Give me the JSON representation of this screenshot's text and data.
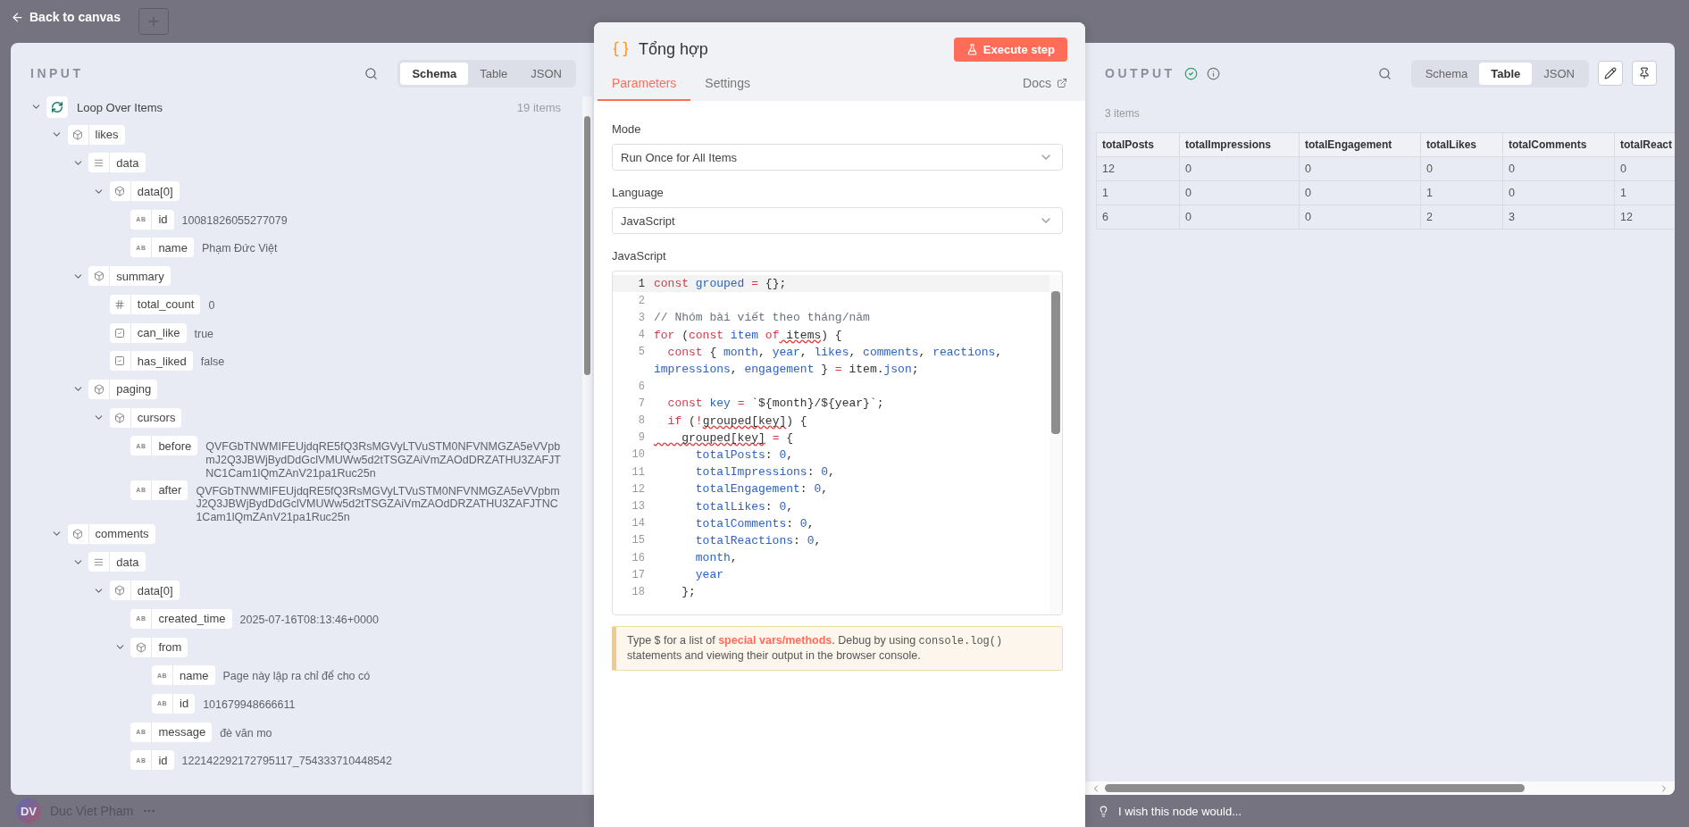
{
  "topbar": {
    "back_label": "Back to canvas"
  },
  "user": {
    "initials": "DV",
    "name": "Duc Viet Pham"
  },
  "input": {
    "title": "INPUT",
    "view_tabs": [
      {
        "label": "Schema",
        "selected": true
      },
      {
        "label": "Table",
        "selected": false
      },
      {
        "label": "JSON",
        "selected": false
      }
    ],
    "tree": {
      "name": "Loop Over Items",
      "count": "19 items",
      "expanded": true,
      "children": [
        {
          "name": "likes",
          "kind": "object",
          "expanded": true,
          "children": [
            {
              "name": "data",
              "kind": "array",
              "expanded": true,
              "children": [
                {
                  "name": "data[0]",
                  "kind": "object",
                  "expanded": true,
                  "children": [
                    {
                      "name": "id",
                      "kind": "string",
                      "type_label": "AB",
                      "value": "10081826055277079"
                    },
                    {
                      "name": "name",
                      "kind": "string",
                      "type_label": "AB",
                      "value": "Phạm Đức Việt"
                    }
                  ]
                }
              ]
            },
            {
              "name": "summary",
              "kind": "object",
              "expanded": true,
              "children": [
                {
                  "name": "total_count",
                  "kind": "number",
                  "value": "0"
                },
                {
                  "name": "can_like",
                  "kind": "boolean",
                  "value": "true"
                },
                {
                  "name": "has_liked",
                  "kind": "boolean",
                  "value": "false"
                }
              ]
            },
            {
              "name": "paging",
              "kind": "object",
              "expanded": true,
              "children": [
                {
                  "name": "cursors",
                  "kind": "object",
                  "expanded": true,
                  "children": [
                    {
                      "name": "before",
                      "kind": "string",
                      "type_label": "AB",
                      "value": "QVFGbTNWMIFEUjdqRE5fQ3RsMGVyLTVuSTM0NFVNMGZA5eVVpbmJ2Q3JBWjBydDdGclVMUWw5d2tTSGZAiVmZAOdDRZATHU3ZAFJTNC1Cam1lQmZAnV21pa1Ruc25n"
                    },
                    {
                      "name": "after",
                      "kind": "string",
                      "type_label": "AB",
                      "value": "QVFGbTNWMIFEUjdqRE5fQ3RsMGVyLTVuSTM0NFVNMGZA5eVVpbmJ2Q3JBWjBydDdGclVMUWw5d2tTSGZAiVmZAOdDRZATHU3ZAFJTNC1Cam1lQmZAnV21pa1Ruc25n"
                    }
                  ]
                }
              ]
            }
          ]
        },
        {
          "name": "comments",
          "kind": "object",
          "expanded": true,
          "children": [
            {
              "name": "data",
              "kind": "array",
              "expanded": true,
              "children": [
                {
                  "name": "data[0]",
                  "kind": "object",
                  "expanded": true,
                  "children": [
                    {
                      "name": "created_time",
                      "kind": "string",
                      "type_label": "AB",
                      "value": "2025-07-16T08:13:46+0000"
                    },
                    {
                      "name": "from",
                      "kind": "object",
                      "expanded": true,
                      "children": [
                        {
                          "name": "name",
                          "kind": "string",
                          "type_label": "AB",
                          "value": "Page này lập ra chỉ để cho có"
                        },
                        {
                          "name": "id",
                          "kind": "string",
                          "type_label": "AB",
                          "value": "101679948666611"
                        }
                      ]
                    },
                    {
                      "name": "message",
                      "kind": "string",
                      "type_label": "AB",
                      "value": "đè văn mo"
                    },
                    {
                      "name": "id",
                      "kind": "string",
                      "type_label": "AB",
                      "value": "122142292172795117_754333710448542"
                    }
                  ]
                }
              ]
            }
          ]
        }
      ]
    }
  },
  "node": {
    "title": "Tổng hợp",
    "execute_label": "Execute step",
    "tabs": [
      {
        "label": "Parameters",
        "selected": true
      },
      {
        "label": "Settings",
        "selected": false
      }
    ],
    "docs_label": "Docs",
    "fields": [
      {
        "label": "Mode",
        "value": "Run Once for All Items"
      },
      {
        "label": "Language",
        "value": "JavaScript"
      }
    ],
    "code_label": "JavaScript",
    "code_lines": [
      {
        "n": "1",
        "active": true,
        "tokens": [
          {
            "kind": "keyword",
            "text": "const"
          },
          {
            "kind": "name",
            "text": " grouped"
          },
          {
            "kind": "keyword",
            "text": " ="
          },
          {
            "kind": "plain",
            "text": " {};"
          }
        ]
      },
      {
        "n": "2",
        "active": false
      },
      {
        "n": "3",
        "active": false,
        "tokens": [
          {
            "kind": "comment",
            "text": "// Nhóm bài viết theo tháng/năm"
          }
        ]
      },
      {
        "n": "4",
        "active": false,
        "tokens": [
          {
            "kind": "keyword",
            "text": "for"
          },
          {
            "kind": "plain",
            "text": " ("
          },
          {
            "kind": "keyword",
            "text": "const"
          },
          {
            "kind": "name",
            "text": " item"
          },
          {
            "kind": "keyword",
            "text": " of"
          },
          {
            "kind": "error",
            "text": " items"
          },
          {
            "kind": "plain",
            "text": ") {"
          }
        ]
      },
      {
        "n": "5",
        "active": false,
        "tokens": [
          {
            "kind": "keyword",
            "text": "  const"
          },
          {
            "kind": "plain",
            "text": " { "
          },
          {
            "kind": "name",
            "text": "month"
          },
          {
            "kind": "plain",
            "text": ", "
          },
          {
            "kind": "name",
            "text": "year"
          },
          {
            "kind": "plain",
            "text": ", "
          },
          {
            "kind": "name",
            "text": "likes"
          },
          {
            "kind": "plain",
            "text": ", "
          },
          {
            "kind": "name",
            "text": "comments"
          },
          {
            "kind": "plain",
            "text": ", "
          },
          {
            "kind": "name",
            "text": "reactions"
          },
          {
            "kind": "plain",
            "text": ","
          }
        ]
      },
      {
        "active": false,
        "tokens": [
          {
            "kind": "name",
            "text": "impressions"
          },
          {
            "kind": "plain",
            "text": ", "
          },
          {
            "kind": "name",
            "text": "engagement"
          },
          {
            "kind": "plain",
            "text": " } "
          },
          {
            "kind": "keyword",
            "text": "="
          },
          {
            "kind": "plain",
            "text": " item."
          },
          {
            "kind": "name",
            "text": "json"
          },
          {
            "kind": "plain",
            "text": ";"
          }
        ]
      },
      {
        "n": "6",
        "active": false
      },
      {
        "n": "7",
        "active": false,
        "tokens": [
          {
            "kind": "keyword",
            "text": "  const"
          },
          {
            "kind": "name",
            "text": " key"
          },
          {
            "kind": "keyword",
            "text": " ="
          },
          {
            "kind": "plain",
            "text": " `${month}/${year}`;"
          }
        ]
      },
      {
        "n": "8",
        "active": false,
        "tokens": [
          {
            "kind": "keyword",
            "text": "  if"
          },
          {
            "kind": "plain",
            "text": " ("
          },
          {
            "kind": "keyword",
            "text": "!"
          },
          {
            "kind": "error",
            "text": "grouped[key]"
          },
          {
            "kind": "plain",
            "text": ") {"
          }
        ]
      },
      {
        "n": "9",
        "active": false,
        "tokens": [
          {
            "kind": "error",
            "text": "    grouped[key]"
          },
          {
            "kind": "keyword",
            "text": " ="
          },
          {
            "kind": "plain",
            "text": " {"
          }
        ]
      },
      {
        "n": "10",
        "active": false,
        "tokens": [
          {
            "kind": "name",
            "text": "      totalPosts"
          },
          {
            "kind": "plain",
            "text": ": "
          },
          {
            "kind": "number",
            "text": "0"
          },
          {
            "kind": "plain",
            "text": ","
          }
        ]
      },
      {
        "n": "11",
        "active": false,
        "tokens": [
          {
            "kind": "name",
            "text": "      totalImpressions"
          },
          {
            "kind": "plain",
            "text": ": "
          },
          {
            "kind": "number",
            "text": "0"
          },
          {
            "kind": "plain",
            "text": ","
          }
        ]
      },
      {
        "n": "12",
        "active": false,
        "tokens": [
          {
            "kind": "name",
            "text": "      totalEngagement"
          },
          {
            "kind": "plain",
            "text": ": "
          },
          {
            "kind": "number",
            "text": "0"
          },
          {
            "kind": "plain",
            "text": ","
          }
        ]
      },
      {
        "n": "13",
        "active": false,
        "tokens": [
          {
            "kind": "name",
            "text": "      totalLikes"
          },
          {
            "kind": "plain",
            "text": ": "
          },
          {
            "kind": "number",
            "text": "0"
          },
          {
            "kind": "plain",
            "text": ","
          }
        ]
      },
      {
        "n": "14",
        "active": false,
        "tokens": [
          {
            "kind": "name",
            "text": "      totalComments"
          },
          {
            "kind": "plain",
            "text": ": "
          },
          {
            "kind": "number",
            "text": "0"
          },
          {
            "kind": "plain",
            "text": ","
          }
        ]
      },
      {
        "n": "15",
        "active": false,
        "tokens": [
          {
            "kind": "name",
            "text": "      totalReactions"
          },
          {
            "kind": "plain",
            "text": ": "
          },
          {
            "kind": "number",
            "text": "0"
          },
          {
            "kind": "plain",
            "text": ","
          }
        ]
      },
      {
        "n": "16",
        "active": false,
        "tokens": [
          {
            "kind": "name",
            "text": "      month"
          },
          {
            "kind": "plain",
            "text": ","
          }
        ]
      },
      {
        "n": "17",
        "active": false,
        "tokens": [
          {
            "kind": "name",
            "text": "      year"
          }
        ]
      },
      {
        "n": "18",
        "active": false,
        "tokens": [
          {
            "kind": "plain",
            "text": "    };"
          }
        ]
      }
    ],
    "hint": {
      "before": "Type $ for a list of ",
      "link": "special vars/methods",
      "middle": ". Debug by using ",
      "code": "console.log()",
      "after": " statements and viewing their output in the browser console."
    }
  },
  "output": {
    "title": "OUTPUT",
    "succeeded": true,
    "view_tabs": [
      {
        "label": "Schema",
        "selected": false
      },
      {
        "label": "Table",
        "selected": true
      },
      {
        "label": "JSON",
        "selected": false
      }
    ],
    "count": "3 items",
    "table": {
      "columns": [
        "totalPosts",
        "totalImpressions",
        "totalEngagement",
        "totalLikes",
        "totalComments",
        "totalReact"
      ],
      "rows": [
        [
          "12",
          "0",
          "0",
          "0",
          "0",
          "0"
        ],
        [
          "1",
          "0",
          "0",
          "1",
          "0",
          "1"
        ],
        [
          "6",
          "0",
          "0",
          "2",
          "3",
          "12"
        ]
      ]
    }
  },
  "feedback": {
    "label": "I wish this node would..."
  }
}
